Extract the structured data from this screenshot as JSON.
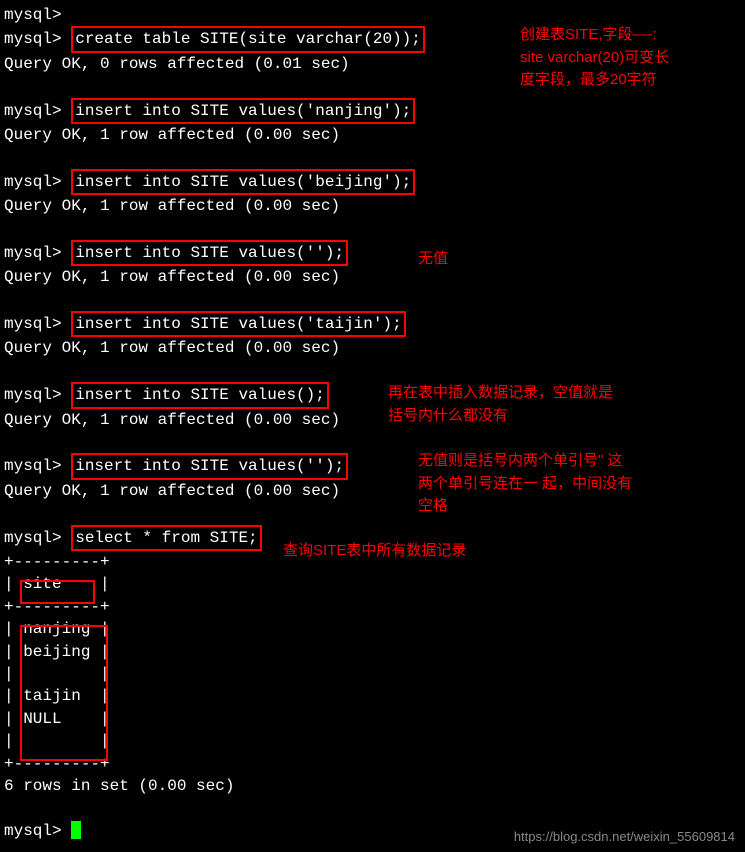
{
  "prompt": "mysql>",
  "commands": {
    "create": "create table SITE(site varchar(20));",
    "insert1": "insert into SITE values('nanjing');",
    "insert2": "insert into SITE values('beijing');",
    "insert3": "insert into SITE values('');",
    "insert4": "insert into SITE values('taijin');",
    "insert5": "insert into SITE values();",
    "insert6": "insert into SITE values('');",
    "select": "select * from SITE;"
  },
  "responses": {
    "ok0": "Query OK, 0 rows affected (0.01 sec)",
    "ok1": "Query OK, 1 row affected (0.00 sec)"
  },
  "table": {
    "border": "+---------+",
    "header": "| site    |",
    "rows": [
      "| nanjing |",
      "| beijing |",
      "|         |",
      "| taijin  |",
      "| NULL    |",
      "|         |"
    ],
    "footer": "6 rows in set (0.00 sec)"
  },
  "annotations": {
    "a1_line1": "创建表SITE,字段—-:",
    "a1_line2": "site varchar(20)可变长",
    "a1_line3": "度字段，最多20字符",
    "a2": "无值",
    "a3_line1": "再在表中插入数据记录，空值就是",
    "a3_line2": "括号内什么都没有",
    "a4_line1": "无值则是括号内两个单引号\" 这",
    "a4_line2": "两个单引号连在一 起，中间没有",
    "a4_line3": "空格",
    "a5": "查询SITE表中所有数据记录"
  },
  "watermark": "https://blog.csdn.net/weixin_55609814"
}
